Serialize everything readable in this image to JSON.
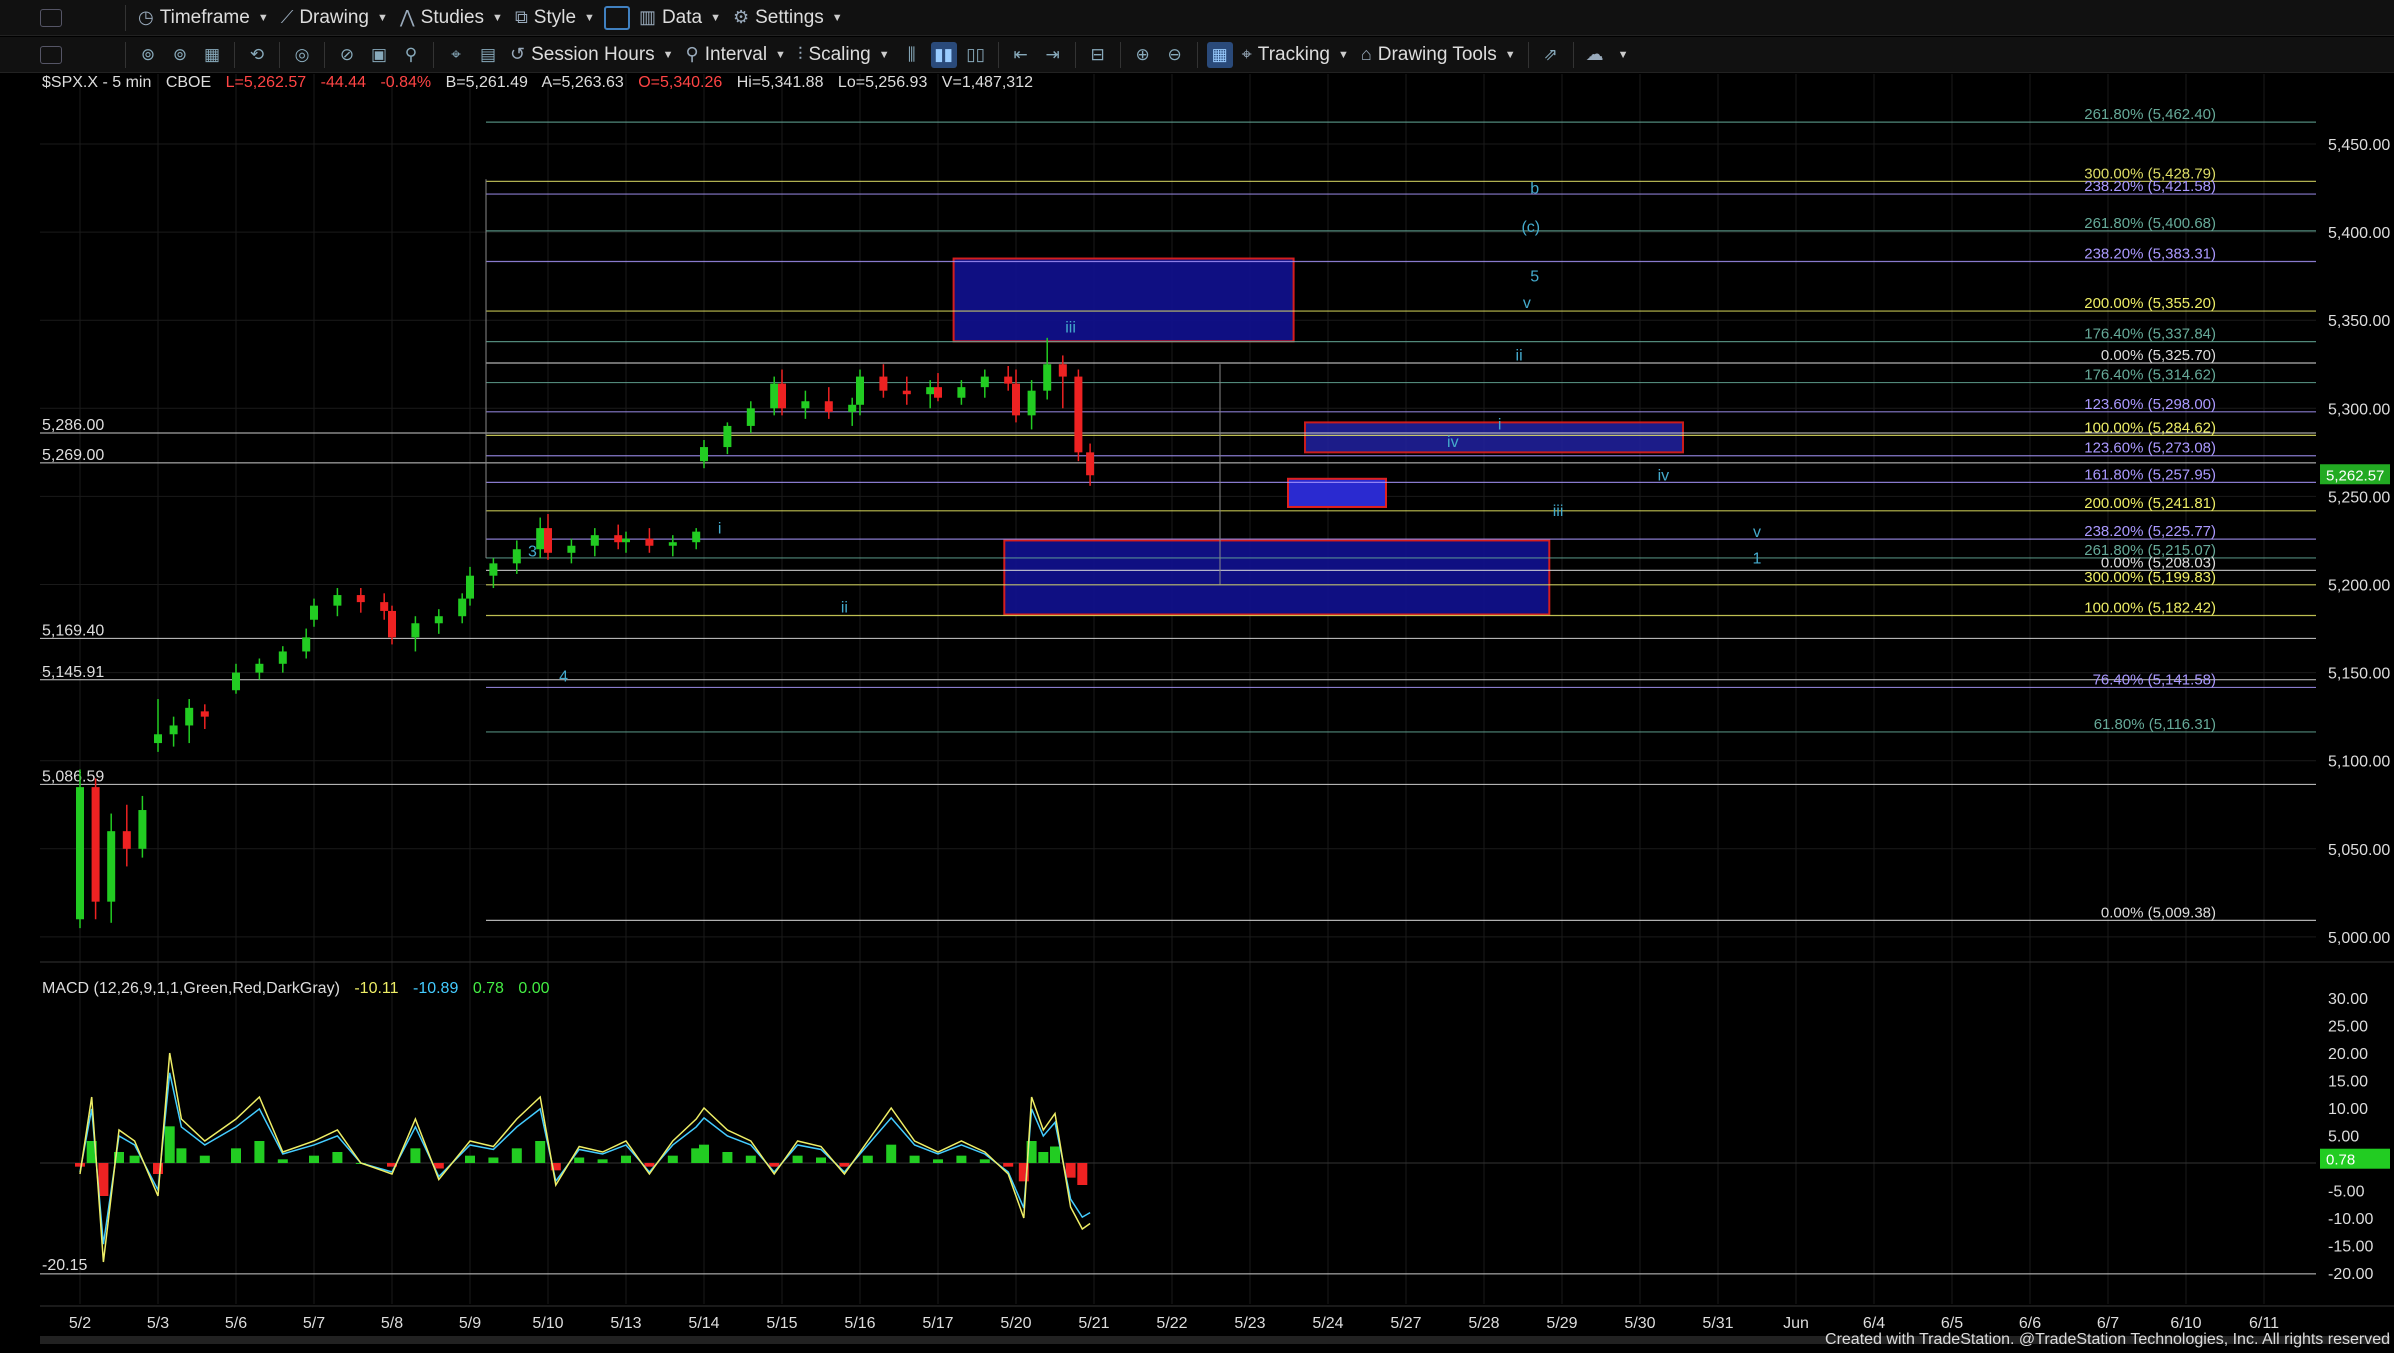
{
  "toolbar1": {
    "timeframe": "Timeframe",
    "drawing": "Drawing",
    "studies": "Studies",
    "style": "Style",
    "data": "Data",
    "settings": "Settings"
  },
  "toolbar2": {
    "session_hours": "Session Hours",
    "interval": "Interval",
    "scaling": "Scaling",
    "tracking": "Tracking",
    "drawing_tools": "Drawing Tools"
  },
  "ohlc": {
    "symbol": "$SPX.X - 5 min",
    "exchange": "CBOE",
    "last": "L=5,262.57",
    "change": "-44.44",
    "change_pct": "-0.84%",
    "bid": "B=5,261.49",
    "ask": "A=5,263.63",
    "open": "O=5,340.26",
    "high": "Hi=5,341.88",
    "low": "Lo=5,256.93",
    "volume": "V=1,487,312"
  },
  "macd": {
    "label": "MACD (12,26,9,1,1,Green,Red,DarkGray)",
    "v1": "-10.11",
    "v2": "-10.89",
    "v3": "0.78",
    "v4": "0.00",
    "low_label": "-20.15",
    "current": "0.78"
  },
  "price_current": "5,262.57",
  "footer": "Created with TradeStation. @TradeStation Technologies, Inc. All rights reserved",
  "colors": {
    "accent_blue": "#1a3d7a",
    "up": "#2c2",
    "down": "#e22",
    "fib_yellow": "#cc9",
    "fib_blue": "#a9f"
  },
  "chart_data": {
    "type": "line",
    "title": "$SPX.X - 5 min",
    "price_axis": [
      "5,450.00",
      "5,400.00",
      "5,350.00",
      "5,300.00",
      "5,250.00",
      "5,200.00",
      "5,150.00",
      "5,100.00",
      "5,050.00",
      "5,000.00"
    ],
    "macd_axis": [
      "30.00",
      "25.00",
      "20.00",
      "15.00",
      "10.00",
      "5.00",
      "-5.00",
      "-10.00",
      "-15.00",
      "-20.00"
    ],
    "dates": [
      "5/2",
      "5/3",
      "5/6",
      "5/7",
      "5/8",
      "5/9",
      "5/10",
      "5/13",
      "5/14",
      "5/15",
      "5/16",
      "5/17",
      "5/20",
      "5/21",
      "5/22",
      "5/23",
      "5/24",
      "5/27",
      "5/28",
      "5/29",
      "5/30",
      "5/31",
      "Jun",
      "6/4",
      "6/5",
      "6/6",
      "6/7",
      "6/10",
      "6/11"
    ],
    "left_levels": [
      {
        "label": "5,286.00",
        "price": 5286.0
      },
      {
        "label": "5,269.00",
        "price": 5269.0
      },
      {
        "label": "5,169.40",
        "price": 5169.4
      },
      {
        "label": "5,145.91",
        "price": 5145.91
      },
      {
        "label": "5,086.59",
        "price": 5086.59
      }
    ],
    "fib_labels": [
      {
        "text": "261.80% (5,462.40)",
        "price": 5462.4,
        "color": "#6a9"
      },
      {
        "text": "300.00% (5,428.79)",
        "price": 5428.79,
        "color": "#dd6"
      },
      {
        "text": "238.20% (5,421.58)",
        "price": 5421.58,
        "color": "#a9f"
      },
      {
        "text": "261.80% (5,400.68)",
        "price": 5400.68,
        "color": "#6a9"
      },
      {
        "text": "238.20% (5,383.31)",
        "price": 5383.31,
        "color": "#a9f"
      },
      {
        "text": "200.00% (5,355.20)",
        "price": 5355.2,
        "color": "#ee6"
      },
      {
        "text": "176.40% (5,337.84)",
        "price": 5337.84,
        "color": "#6a9"
      },
      {
        "text": "0.00% (5,325.70)",
        "price": 5325.7,
        "color": "#ddd"
      },
      {
        "text": "176.40% (5,314.62)",
        "price": 5314.62,
        "color": "#6a9"
      },
      {
        "text": "123.60% (5,298.00)",
        "price": 5298.0,
        "color": "#a9f"
      },
      {
        "text": "100.00% (5,284.62)",
        "price": 5284.62,
        "color": "#ee6"
      },
      {
        "text": "123.60% (5,273.08)",
        "price": 5273.08,
        "color": "#a9f"
      },
      {
        "text": "161.80% (5,257.95)",
        "price": 5257.95,
        "color": "#a9f"
      },
      {
        "text": "200.00% (5,241.81)",
        "price": 5241.81,
        "color": "#ee6"
      },
      {
        "text": "238.20% (5,225.77)",
        "price": 5225.77,
        "color": "#a9f"
      },
      {
        "text": "261.80% (5,215.07)",
        "price": 5215.07,
        "color": "#6a9"
      },
      {
        "text": "0.00% (5,208.03)",
        "price": 5208.03,
        "color": "#ddd"
      },
      {
        "text": "300.00% (5,199.83)",
        "price": 5199.83,
        "color": "#ee6"
      },
      {
        "text": "100.00% (5,182.42)",
        "price": 5182.42,
        "color": "#ee6"
      },
      {
        "text": "76.40% (5,141.58)",
        "price": 5141.58,
        "color": "#a9f"
      },
      {
        "text": "61.80% (5,116.31)",
        "price": 5116.31,
        "color": "#6a9"
      },
      {
        "text": "0.00% (5,009.38)",
        "price": 5009.38,
        "color": "#ddd"
      }
    ],
    "wave_labels": [
      {
        "text": "3",
        "x": 5.8,
        "price": 5216
      },
      {
        "text": "4",
        "x": 6.2,
        "price": 5145
      },
      {
        "text": "i",
        "x": 8.2,
        "price": 5229
      },
      {
        "text": "ii",
        "x": 9.8,
        "price": 5184
      },
      {
        "text": "iii",
        "x": 12.7,
        "price": 5343
      },
      {
        "text": "iv",
        "x": 17.6,
        "price": 5278
      },
      {
        "text": "i",
        "x": 18.2,
        "price": 5288
      },
      {
        "text": "ii",
        "x": 18.45,
        "price": 5327
      },
      {
        "text": "iii",
        "x": 18.95,
        "price": 5239
      },
      {
        "text": "iv",
        "x": 20.3,
        "price": 5259
      },
      {
        "text": "v",
        "x": 21.5,
        "price": 5227
      },
      {
        "text": "1",
        "x": 21.5,
        "price": 5212
      },
      {
        "text": "b",
        "x": 18.65,
        "price": 5422
      },
      {
        "text": "(c)",
        "x": 18.6,
        "price": 5400
      },
      {
        "text": "5",
        "x": 18.65,
        "price": 5372
      },
      {
        "text": "v",
        "x": 18.55,
        "price": 5357
      }
    ],
    "candles": [
      [
        0.0,
        5010,
        5095,
        5005,
        5085
      ],
      [
        0.2,
        5085,
        5090,
        5010,
        5020
      ],
      [
        0.4,
        5020,
        5070,
        5008,
        5060
      ],
      [
        0.6,
        5060,
        5075,
        5040,
        5050
      ],
      [
        0.8,
        5050,
        5080,
        5045,
        5072
      ],
      [
        1.0,
        5110,
        5135,
        5105,
        5115
      ],
      [
        1.2,
        5115,
        5125,
        5108,
        5120
      ],
      [
        1.4,
        5120,
        5135,
        5110,
        5130
      ],
      [
        1.6,
        5128,
        5132,
        5118,
        5125
      ],
      [
        2.0,
        5140,
        5155,
        5138,
        5150
      ],
      [
        2.3,
        5150,
        5158,
        5146,
        5155
      ],
      [
        2.6,
        5155,
        5165,
        5150,
        5162
      ],
      [
        2.9,
        5162,
        5175,
        5158,
        5170
      ],
      [
        3.0,
        5180,
        5192,
        5176,
        5188
      ],
      [
        3.3,
        5188,
        5198,
        5182,
        5194
      ],
      [
        3.6,
        5194,
        5198,
        5184,
        5190
      ],
      [
        3.9,
        5190,
        5195,
        5180,
        5185
      ],
      [
        4.0,
        5185,
        5188,
        5166,
        5170
      ],
      [
        4.3,
        5170,
        5182,
        5162,
        5178
      ],
      [
        4.6,
        5178,
        5186,
        5172,
        5182
      ],
      [
        4.9,
        5182,
        5195,
        5178,
        5192
      ],
      [
        5.0,
        5192,
        5210,
        5188,
        5205
      ],
      [
        5.3,
        5205,
        5215,
        5198,
        5212
      ],
      [
        5.6,
        5212,
        5225,
        5206,
        5220
      ],
      [
        5.9,
        5220,
        5238,
        5215,
        5232
      ],
      [
        6.0,
        5232,
        5240,
        5214,
        5218
      ],
      [
        6.3,
        5218,
        5226,
        5212,
        5222
      ],
      [
        6.6,
        5222,
        5232,
        5216,
        5228
      ],
      [
        6.9,
        5228,
        5234,
        5220,
        5224
      ],
      [
        7.0,
        5224,
        5230,
        5218,
        5226
      ],
      [
        7.3,
        5226,
        5232,
        5218,
        5222
      ],
      [
        7.6,
        5222,
        5228,
        5216,
        5224
      ],
      [
        7.9,
        5224,
        5232,
        5220,
        5230
      ],
      [
        8.0,
        5270,
        5282,
        5266,
        5278
      ],
      [
        8.3,
        5278,
        5292,
        5274,
        5290
      ],
      [
        8.6,
        5290,
        5304,
        5286,
        5300
      ],
      [
        8.9,
        5300,
        5318,
        5296,
        5314
      ],
      [
        9.0,
        5314,
        5322,
        5296,
        5300
      ],
      [
        9.3,
        5300,
        5310,
        5294,
        5304
      ],
      [
        9.6,
        5304,
        5312,
        5294,
        5298
      ],
      [
        9.9,
        5298,
        5306,
        5290,
        5302
      ],
      [
        10.0,
        5302,
        5322,
        5296,
        5318
      ],
      [
        10.3,
        5318,
        5325,
        5306,
        5310
      ],
      [
        10.6,
        5310,
        5318,
        5302,
        5308
      ],
      [
        10.9,
        5308,
        5316,
        5300,
        5312
      ],
      [
        11.0,
        5312,
        5320,
        5304,
        5306
      ],
      [
        11.3,
        5306,
        5316,
        5302,
        5312
      ],
      [
        11.6,
        5312,
        5322,
        5306,
        5318
      ],
      [
        11.9,
        5318,
        5324,
        5310,
        5314
      ],
      [
        12.0,
        5314,
        5322,
        5292,
        5296
      ],
      [
        12.2,
        5296,
        5316,
        5288,
        5310
      ],
      [
        12.4,
        5310,
        5340,
        5305,
        5325
      ],
      [
        12.6,
        5325,
        5330,
        5300,
        5318
      ],
      [
        12.8,
        5318,
        5322,
        5270,
        5275
      ],
      [
        12.95,
        5275,
        5280,
        5256,
        5262
      ]
    ],
    "macd_line": [
      [
        0.0,
        -2
      ],
      [
        0.15,
        12
      ],
      [
        0.3,
        -18
      ],
      [
        0.5,
        6
      ],
      [
        0.7,
        4
      ],
      [
        1.0,
        -6
      ],
      [
        1.15,
        20
      ],
      [
        1.3,
        8
      ],
      [
        1.6,
        4
      ],
      [
        2.0,
        8
      ],
      [
        2.3,
        12
      ],
      [
        2.6,
        2
      ],
      [
        3.0,
        4
      ],
      [
        3.3,
        6
      ],
      [
        3.6,
        0
      ],
      [
        4.0,
        -2
      ],
      [
        4.3,
        8
      ],
      [
        4.6,
        -3
      ],
      [
        5.0,
        4
      ],
      [
        5.3,
        3
      ],
      [
        5.6,
        8
      ],
      [
        5.9,
        12
      ],
      [
        6.1,
        -4
      ],
      [
        6.4,
        3
      ],
      [
        6.7,
        2
      ],
      [
        7.0,
        4
      ],
      [
        7.3,
        -2
      ],
      [
        7.6,
        4
      ],
      [
        7.9,
        8
      ],
      [
        8.0,
        10
      ],
      [
        8.3,
        6
      ],
      [
        8.6,
        4
      ],
      [
        8.9,
        -2
      ],
      [
        9.2,
        4
      ],
      [
        9.5,
        3
      ],
      [
        9.8,
        -2
      ],
      [
        10.1,
        4
      ],
      [
        10.4,
        10
      ],
      [
        10.7,
        4
      ],
      [
        11.0,
        2
      ],
      [
        11.3,
        4
      ],
      [
        11.6,
        2
      ],
      [
        11.9,
        -2
      ],
      [
        12.1,
        -10
      ],
      [
        12.2,
        12
      ],
      [
        12.35,
        6
      ],
      [
        12.5,
        9
      ],
      [
        12.7,
        -8
      ],
      [
        12.85,
        -12
      ],
      [
        12.95,
        -11
      ]
    ]
  }
}
